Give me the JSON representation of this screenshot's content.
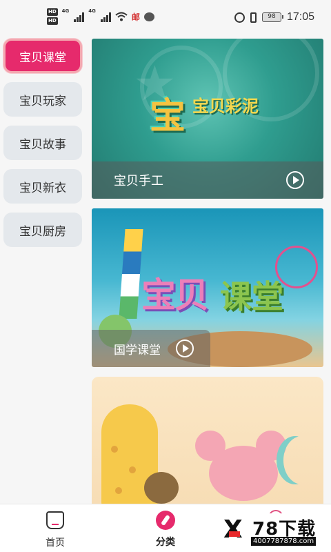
{
  "status_bar": {
    "hd1": "HD",
    "hd2": "HD",
    "net1": "4G",
    "net2": "4G",
    "carrier_icon": "邮",
    "battery": "98",
    "time": "17:05"
  },
  "sidebar": {
    "items": [
      {
        "label": "宝贝课堂",
        "active": true
      },
      {
        "label": "宝贝玩家",
        "active": false
      },
      {
        "label": "宝贝故事",
        "active": false
      },
      {
        "label": "宝贝新衣",
        "active": false
      },
      {
        "label": "宝贝厨房",
        "active": false
      }
    ]
  },
  "cards": [
    {
      "art_text": "宝",
      "art_sub": "宝贝彩泥",
      "caption": "宝贝手工"
    },
    {
      "art_text": "宝贝",
      "art_sub": "课堂",
      "caption": "国学课堂"
    },
    {
      "caption": ""
    }
  ],
  "tab_bar": {
    "tabs": [
      {
        "label": "首页",
        "icon": "home-icon"
      },
      {
        "label": "分类",
        "icon": "compass-icon",
        "active": true
      },
      {
        "label": "",
        "icon": "person-icon"
      }
    ]
  },
  "watermark": {
    "mark": "X",
    "brand": "78下载",
    "url": "4007787878.com"
  },
  "colors": {
    "accent": "#e62a6c",
    "sidebar_bg": "#e4e8ec",
    "page_bg": "#f6f6f6"
  }
}
